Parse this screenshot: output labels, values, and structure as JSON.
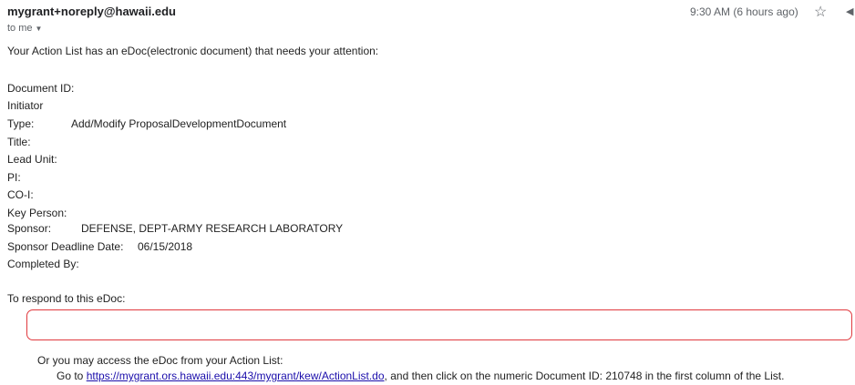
{
  "email": {
    "sender": "mygrant+noreply@hawaii.edu",
    "recipient": "to me",
    "time": "9:30 AM (6 hours ago)"
  },
  "icons": {
    "star": "star-icon",
    "reply": "reply-icon",
    "caret": "caret-down-icon"
  },
  "body": {
    "intro": "Your Action List has an eDoc(electronic document) that needs your attention:",
    "fields": {
      "document_id": "Document ID:",
      "initiator": "Initiator",
      "type_label": "Type:",
      "type_value": "Add/Modify ProposalDevelopmentDocument",
      "title": "Title:",
      "lead_unit": "Lead Unit:",
      "pi": "PI:",
      "co_i": "CO-I:",
      "key_person": "Key Person:",
      "sponsor_label": "Sponsor:",
      "sponsor_value": "DEFENSE, DEPT-ARMY RESEARCH LABORATORY",
      "deadline_label": "Sponsor Deadline Date:",
      "deadline_value": "06/15/2018",
      "completed_by": "Completed By:"
    },
    "respond": "To respond to this eDoc:",
    "access": "Or you may access the eDoc from your Action List:",
    "goto_prefix": "Go to",
    "action_list_link": "https://mygrant.ors.hawaii.edu:443/mygrant/kew/ActionList.do",
    "goto_suffix": ", and then click on the numeric Document ID: 210748 in the first column of the List."
  },
  "colors": {
    "highlight_box": "#e0393e",
    "link": "#1a0dab"
  }
}
